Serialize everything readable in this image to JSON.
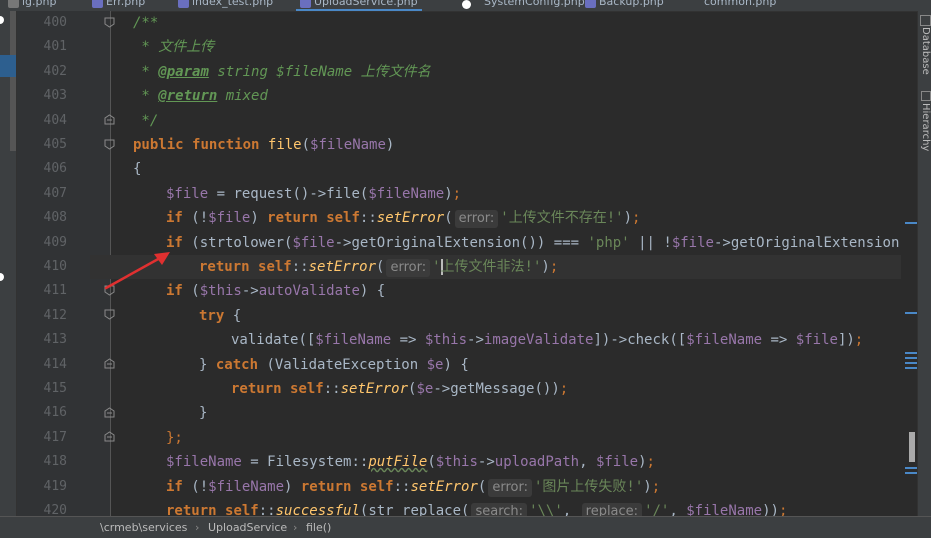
{
  "tabs": [
    {
      "label": "ig.php",
      "active": false
    },
    {
      "label": "Err.php",
      "active": false
    },
    {
      "label": "index_test.php",
      "active": false
    },
    {
      "label": "UploadService.php",
      "active": true
    },
    {
      "label": "SystemConfig.php",
      "active": false
    },
    {
      "label": "Backup.php",
      "active": false
    },
    {
      "label": "common.php",
      "active": false
    }
  ],
  "tool_windows": {
    "database": "Database",
    "hierarchy": "Hierarchy"
  },
  "line_numbers": [
    "400",
    "401",
    "402",
    "403",
    "404",
    "405",
    "406",
    "407",
    "408",
    "409",
    "410",
    "411",
    "412",
    "413",
    "414",
    "415",
    "416",
    "417",
    "418",
    "419",
    "420"
  ],
  "code": {
    "l400": "/**",
    "l401": " * 文件上传",
    "l402_a": " * ",
    "l402_tag": "@param",
    "l402_b": " string $fileName 上传文件名",
    "l403_a": " * ",
    "l403_tag": "@return",
    "l403_b": " mixed",
    "l404": " */",
    "l405_kw1": "public",
    "l405_kw2": "function",
    "l405_fn": "file",
    "l405_var": "$fileName",
    "l406": "{",
    "l407_var": "$file",
    "l407_eq": " = ",
    "l407_req": "request",
    "l407_arrow": "()->",
    "l407_file": "file",
    "l407_arg": "$fileName",
    "l408_if": "if",
    "l408_not": " (!",
    "l408_var": "$file",
    "l408_ret": "return",
    "l408_self": "self",
    "l408_fn": "setError",
    "l408_hint": "error:",
    "l408_str": "'上传文件不存在!'",
    "l409_if": "if",
    "l409_lower": "strtolower",
    "l409_var": "$file",
    "l409_ext": "getOriginalExtension",
    "l409_eqq": " === ",
    "l409_php": "'php'",
    "l409_or": " || !",
    "l409_var2": "$file",
    "l409_ext2": "getOriginalExtension",
    "l410_ret": "return",
    "l410_self": "self",
    "l410_fn": "setError",
    "l410_hint": "error:",
    "l410_q": "'",
    "l410_str": "上传文件非法!'",
    "l411_if": "if",
    "l411_this": "$this",
    "l411_prop": "autoValidate",
    "l412_try": "try",
    "l413_val": "validate",
    "l413_var": "$fileName",
    "l413_this": "$this",
    "l413_prop": "imageValidate",
    "l413_check": "check",
    "l413_var2": "$fileName",
    "l413_var3": "$file",
    "l414_catch": "catch",
    "l414_cls": "ValidateException",
    "l414_var": "$e",
    "l415_ret": "return",
    "l415_self": "self",
    "l415_fn": "setError",
    "l415_var": "$e",
    "l415_msg": "getMessage",
    "l416": "}",
    "l417": "};",
    "l418_var": "$fileName",
    "l418_cls": "Filesystem",
    "l418_fn": "putFile",
    "l418_this": "$this",
    "l418_prop": "uploadPath",
    "l418_var2": "$file",
    "l419_if": "if",
    "l419_var": "$fileName",
    "l419_ret": "return",
    "l419_self": "self",
    "l419_fn": "setError",
    "l419_hint": "error:",
    "l419_str": "'图片上传失败!'",
    "l420_ret": "return",
    "l420_self": "self",
    "l420_fn": "successful",
    "l420_rep": "str_replace",
    "l420_hint1": "search:",
    "l420_s1": "'\\\\'",
    "l420_hint2": "replace:",
    "l420_s2": "'/'",
    "l420_var": "$fileName"
  },
  "breadcrumb": [
    "\\crmeb\\services",
    "UploadService",
    "file()"
  ],
  "colors": {
    "background": "#2b2b2b",
    "keyword": "#cc7832",
    "string": "#6a8759",
    "variable": "#9876aa",
    "function": "#ffc66d",
    "comment": "#629755",
    "arrow": "#e03030"
  }
}
